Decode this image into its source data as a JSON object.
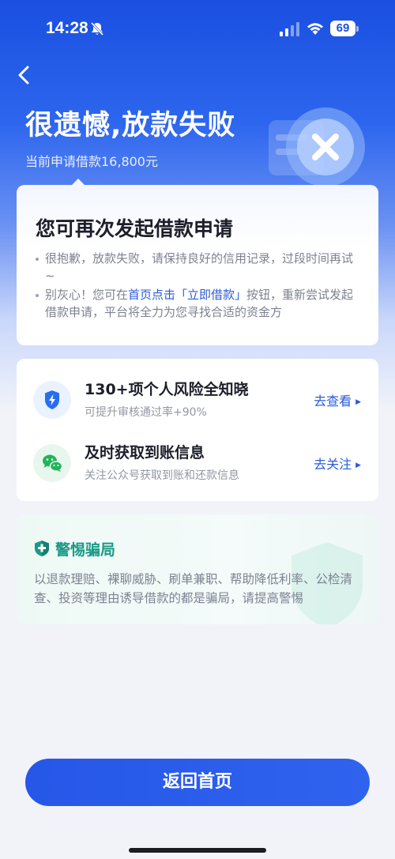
{
  "status_bar": {
    "time": "14:28",
    "battery": "69"
  },
  "header": {
    "title": "很遗憾,放款失败",
    "subtitle": "当前申请借款16,800元"
  },
  "main_card": {
    "title": "您可再次发起借款申请",
    "tip1": "很抱歉，放款失败，请保持良好的信用记录，过段时间再试~",
    "tip2_prefix": "别灰心！您可在",
    "tip2_highlight": "首页点击「立即借款」",
    "tip2_suffix": "按钮，重新尝试发起借款申请，平台将全力为您寻找合适的资金方"
  },
  "services": [
    {
      "title": "130+项个人风险全知晓",
      "desc": "可提升审核通过率+90%",
      "link": "去查看",
      "icon": "shield-bolt-icon"
    },
    {
      "title": "及时获取到账信息",
      "desc": "关注公众号获取到账和还款信息",
      "link": "去关注",
      "icon": "wechat-icon"
    }
  ],
  "warning": {
    "title": "警惕骗局",
    "text": "以退款理赔、裸聊威胁、刷单兼职、帮助降低利率、公检清查、投资等理由诱导借款的都是骗局，请提高警惕"
  },
  "footer": {
    "button_label": "返回首页"
  },
  "colors": {
    "primary": "#2a5ad8",
    "warning_green": "#1a9a86",
    "hero_blue": "#1a4fe0"
  }
}
